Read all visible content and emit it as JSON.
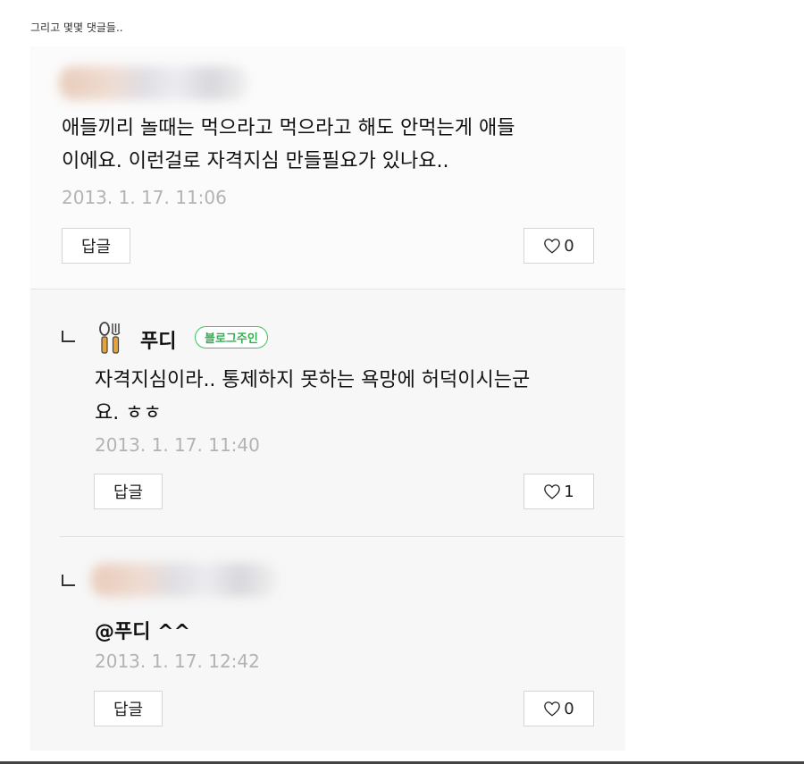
{
  "caption": "그리고 몇몇 댓글들..",
  "comments": [
    {
      "text": "애들끼리 놀때는 먹으라고 먹으라고 해도 안먹는게 애들\n이에요. 이런걸로 자격지심 만들필요가 있나요..",
      "timestamp": "2013. 1. 17. 11:06",
      "reply_label": "답글",
      "like_count": "0"
    },
    {
      "author": "푸디",
      "badge": "블로그주인",
      "text": "자격지심이라.. 통제하지 못하는 욕망에 허덕이시는군\n요. ㅎㅎ",
      "timestamp": "2013. 1. 17. 11:40",
      "reply_label": "답글",
      "like_count": "1"
    },
    {
      "text": "@푸디 ^^",
      "timestamp": "2013. 1. 17. 12:42",
      "reply_label": "답글",
      "like_count": "0"
    }
  ],
  "colors": {
    "badge_green": "#2fb24f",
    "timestamp_gray": "#b3b3b3",
    "card_background": "#f7f7f7"
  },
  "icons": {
    "like": "heart-outline-icon",
    "owner_avatar": "spoon-fork-icon",
    "reply_indicator": "reply-corner-icon"
  }
}
